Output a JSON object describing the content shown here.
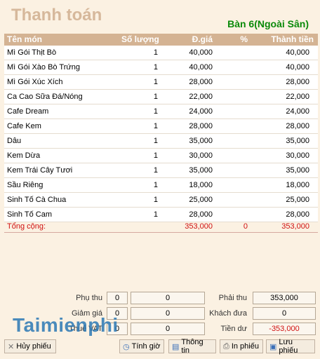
{
  "title": "Thanh toán",
  "table_label": "Bàn 6(Ngoài Sân)",
  "columns": {
    "name": "Tên món",
    "qty": "Số lượng",
    "price": "Đ.giá",
    "pct": "%",
    "total": "Thành tiền"
  },
  "items": [
    {
      "name": "Mì Gói Thịt Bò",
      "qty": "1",
      "price": "40,000",
      "total": "40,000"
    },
    {
      "name": "Mì Gói Xào Bò Trứng",
      "qty": "1",
      "price": "40,000",
      "total": "40,000"
    },
    {
      "name": "Mì Gói Xúc Xích",
      "qty": "1",
      "price": "28,000",
      "total": "28,000"
    },
    {
      "name": "Ca Cao Sữa Đá/Nóng",
      "qty": "1",
      "price": "22,000",
      "total": "22,000"
    },
    {
      "name": "Cafe Dream",
      "qty": "1",
      "price": "24,000",
      "total": "24,000"
    },
    {
      "name": "Cafe Kem",
      "qty": "1",
      "price": "28,000",
      "total": "28,000"
    },
    {
      "name": "Dâu",
      "qty": "1",
      "price": "35,000",
      "total": "35,000"
    },
    {
      "name": "Kem Dừa",
      "qty": "1",
      "price": "30,000",
      "total": "30,000"
    },
    {
      "name": "Kem Trái Cây Tươi",
      "qty": "1",
      "price": "35,000",
      "total": "35,000"
    },
    {
      "name": "Sầu Riêng",
      "qty": "1",
      "price": "18,000",
      "total": "18,000"
    },
    {
      "name": "Sinh Tố Cà Chua",
      "qty": "1",
      "price": "25,000",
      "total": "25,000"
    },
    {
      "name": "Sinh Tố Cam",
      "qty": "1",
      "price": "28,000",
      "total": "28,000"
    }
  ],
  "total_row": {
    "label": "Tổng cộng:",
    "price": "353,000",
    "pct": "0",
    "total": "353,000"
  },
  "summary": {
    "phu_thu_label": "Phụ thu",
    "phu_thu_pct": "0",
    "phu_thu_value": "0",
    "giam_gia_label": "Giảm giá",
    "giam_gia_pct": "0",
    "giam_gia_value": "0",
    "thue_vat_label": "Thuế VAT",
    "thue_vat_pct": "0",
    "thue_vat_value": "0",
    "phai_thu_label": "Phải thu",
    "phai_thu_value": "353,000",
    "khach_dua_label": "Khách đưa",
    "khach_dua_value": "0",
    "tien_du_label": "Tiền dư",
    "tien_du_value": "-353,000"
  },
  "buttons": {
    "huy_phieu": "Hủy phiếu",
    "tinh_gio": "Tính giờ",
    "thong_tin": "Thông tin",
    "in_phieu": "In phiếu",
    "luu_phieu": "Lưu phiếu"
  },
  "watermark": "Taimienphi",
  "colors": {
    "header_bg": "#d4b393",
    "title": "#d6b89b",
    "table_label": "#0a8a0a",
    "total_row": "#d01010",
    "tien_du": "#d01010"
  }
}
